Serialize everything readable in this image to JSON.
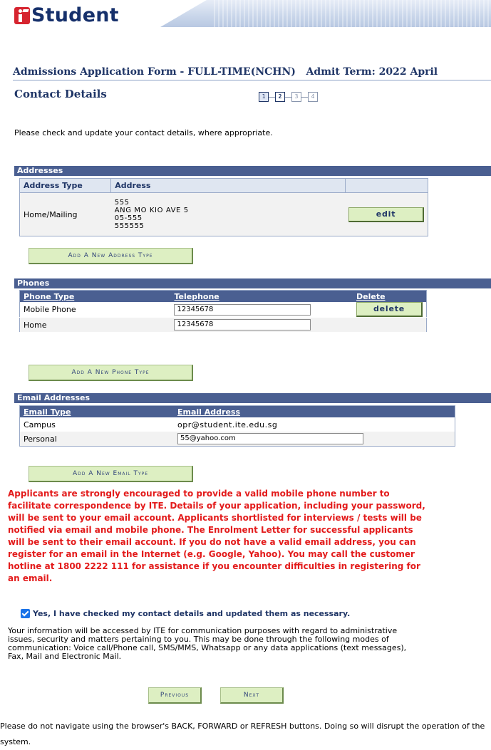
{
  "brand": {
    "name": "Student",
    "logo_color": "#d6242f",
    "text_color": "#16306b"
  },
  "header": {
    "title": "Admissions Application Form - FULL-TIME(NCHN)",
    "admit_term": "Admit Term: 2022 April",
    "section": "Contact Details",
    "steps": [
      "1",
      "2",
      "3",
      "4"
    ],
    "current_step": "2"
  },
  "intro": "Please check and update your contact details, where appropriate.",
  "addresses": {
    "heading": "Addresses",
    "col_type": "Address Type",
    "col_address": "Address",
    "rows": [
      {
        "type": "Home/Mailing",
        "lines": [
          "555",
          "ANG MO KIO AVE 5",
          "05-555",
          "555555"
        ],
        "action": "edit"
      }
    ],
    "add_button": "Add A New Address Type"
  },
  "phones": {
    "heading": "Phones",
    "col_type": "Phone Type",
    "col_tel": "Telephone",
    "col_delete": "Delete",
    "rows": [
      {
        "type": "Mobile Phone",
        "value": "12345678",
        "action": "delete"
      },
      {
        "type": "Home",
        "value": "12345678"
      }
    ],
    "add_button": "Add A New Phone Type"
  },
  "emails": {
    "heading": "Email Addresses",
    "col_type": "Email Type",
    "col_addr": "Email Address",
    "rows": [
      {
        "type": "Campus",
        "value": "opr@student.ite.edu.sg"
      },
      {
        "type": "Personal",
        "value": "55@yahoo.com"
      }
    ],
    "add_button": "Add A New Email Type"
  },
  "notice": "Applicants are strongly encouraged to provide a valid mobile phone number to facilitate correspondence by ITE. Details of your application, including your password, will be sent to your email account. Applicants shortlisted for interviews / tests will be notified via email and mobile phone. The Enrolment Letter for successful applicants will be sent to their email account. If you do not have a valid email address, you can register for an email in the Internet (e.g. Google, Yahoo). You may call the customer hotline at 1800 2222 111 for assistance if you encounter difficulties in registering for an email.",
  "confirm": {
    "checked": true,
    "label": "Yes, I have checked my contact details and updated them as necessary."
  },
  "consent": "Your information will be accessed by ITE for communication purposes with regard to administrative issues, security and matters pertaining to you. This may be done through the following modes of communication: Voice call/Phone call, SMS/MMS, Whatsapp or any data applications (text messages), Fax, Mail and Electronic Mail.",
  "nav": {
    "previous": "Previous",
    "next": "Next"
  },
  "footer": "Please do not navigate using the browser's BACK, FORWARD or REFRESH buttons. Doing so will disrupt the operation of the system.",
  "colors": {
    "grid_header": "#4a5f91",
    "button_bg": "#ddefc2",
    "notice": "#e31b1b",
    "title": "#1f3566"
  }
}
